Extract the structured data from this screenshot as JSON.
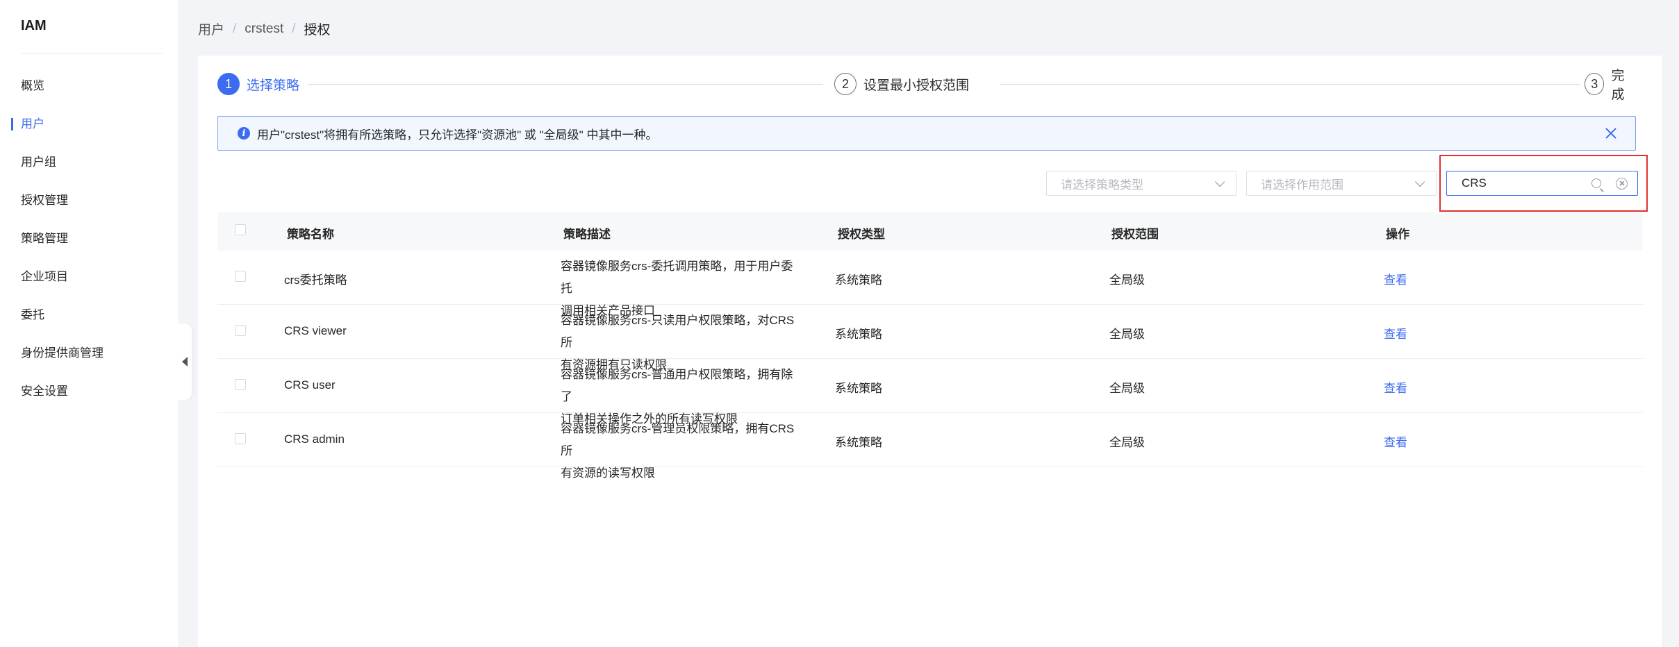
{
  "app": {
    "title": "IAM"
  },
  "sidebar": {
    "items": [
      {
        "label": "概览",
        "active": false
      },
      {
        "label": "用户",
        "active": true
      },
      {
        "label": "用户组",
        "active": false
      },
      {
        "label": "授权管理",
        "active": false
      },
      {
        "label": "策略管理",
        "active": false
      },
      {
        "label": "企业项目",
        "active": false
      },
      {
        "label": "委托",
        "active": false
      },
      {
        "label": "身份提供商管理",
        "active": false
      },
      {
        "label": "安全设置",
        "active": false
      }
    ]
  },
  "breadcrumb": {
    "items": [
      "用户",
      "crstest",
      "授权"
    ],
    "separator": "/"
  },
  "steps": [
    {
      "num": "1",
      "label": "选择策略",
      "active": true
    },
    {
      "num": "2",
      "label": "设置最小授权范围",
      "active": false
    },
    {
      "num": "3",
      "label": "完成",
      "active": false
    }
  ],
  "alert": {
    "icon": "info-icon",
    "text": "用户\"crstest\"将拥有所选策略，只允许选择\"资源池\" 或 \"全局级\" 中其中一种。"
  },
  "filters": {
    "policy_type_placeholder": "请选择策略类型",
    "scope_placeholder": "请选择作用范围",
    "search_value": "CRS"
  },
  "table": {
    "columns": [
      "策略名称",
      "策略描述",
      "授权类型",
      "授权范围",
      "操作"
    ],
    "rows": [
      {
        "name": "crs委托策略",
        "desc_line1": "容器镜像服务crs-委托调用策略，用于用户委托",
        "desc_line2": "调用相关产品接口",
        "type": "系统策略",
        "scope": "全局级",
        "action": "查看"
      },
      {
        "name": "CRS viewer",
        "desc_line1": "容器镜像服务crs-只读用户权限策略，对CRS所",
        "desc_line2": "有资源拥有只读权限",
        "type": "系统策略",
        "scope": "全局级",
        "action": "查看"
      },
      {
        "name": "CRS user",
        "desc_line1": "容器镜像服务crs-普通用户权限策略，拥有除了",
        "desc_line2": "订单相关操作之外的所有读写权限",
        "type": "系统策略",
        "scope": "全局级",
        "action": "查看"
      },
      {
        "name": "CRS admin",
        "desc_line1": "容器镜像服务crs-管理员权限策略，拥有CRS所",
        "desc_line2": "有资源的读写权限",
        "type": "系统策略",
        "scope": "全局级",
        "action": "查看"
      }
    ]
  },
  "colors": {
    "accent": "#3b6cf0",
    "highlight": "#e03131"
  }
}
